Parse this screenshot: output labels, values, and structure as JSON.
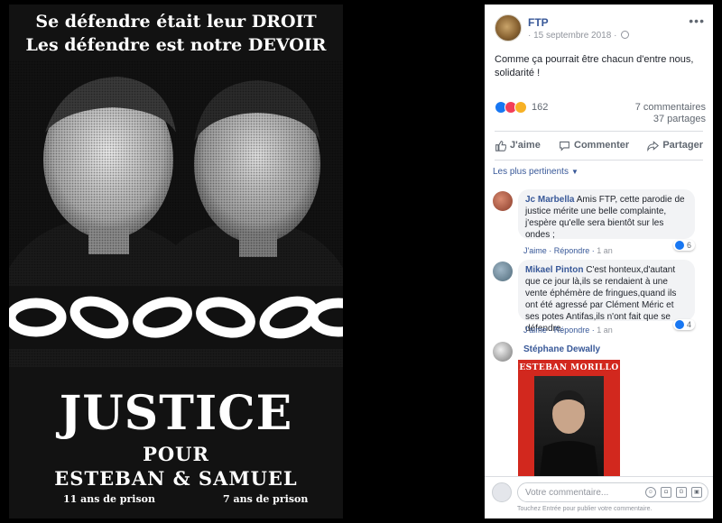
{
  "poster": {
    "headline_1": "Se défendre était leur DROIT",
    "headline_2": "Les défendre est notre DEVOIR",
    "justice": "JUSTICE",
    "pour": "POUR",
    "names": "ESTEBAN & SAMUEL",
    "sentence_left": "11 ans de prison",
    "sentence_right": "7 ans de prison"
  },
  "post": {
    "page_name": "FTP",
    "date": "15 septembre 2018",
    "separator": "·",
    "text": "Comme ça pourrait être chacun d'entre nous, solidarité !",
    "reactions": {
      "count": "162",
      "icons": [
        "like-icon",
        "love-icon",
        "sad-icon"
      ]
    },
    "comments_count": "7 commentaires",
    "shares_count": "37 partages",
    "actions": {
      "like": "J'aime",
      "comment": "Commenter",
      "share": "Partager"
    },
    "sort_label": "Les plus pertinents"
  },
  "comments": [
    {
      "author": "Jc Marbella",
      "text": "Amis FTP, cette parodie de justice mérite une belle complainte, j'espère qu'elle sera bientôt sur les ondes ;",
      "like_label": "J'aime",
      "reply_label": "Répondre",
      "age": "1 an",
      "reactions": "6"
    },
    {
      "author": "Mikael Pinton",
      "text": "C'est honteux,d'autant que ce jour là,ils se rendaient à une vente éphémère de fringues,quand ils ont été agressé par Clément Méric et ses potes Antifas,ils n'ont fait que se défendre.",
      "like_label": "J'aime",
      "reply_label": "Répondre",
      "age": "1 an",
      "reactions": "4"
    },
    {
      "author": "Stéphane Dewally",
      "image_title": "ESTEBAN MORILLO"
    }
  ],
  "composer": {
    "placeholder": "Votre commentaire...",
    "hint": "Touchez Entrée pour publier votre commentaire."
  },
  "colors": {
    "link": "#385898",
    "like_blue": "#1877f2",
    "love_red": "#f33e58",
    "sad_yellow": "#f7b125",
    "card_red": "#d2281e"
  }
}
